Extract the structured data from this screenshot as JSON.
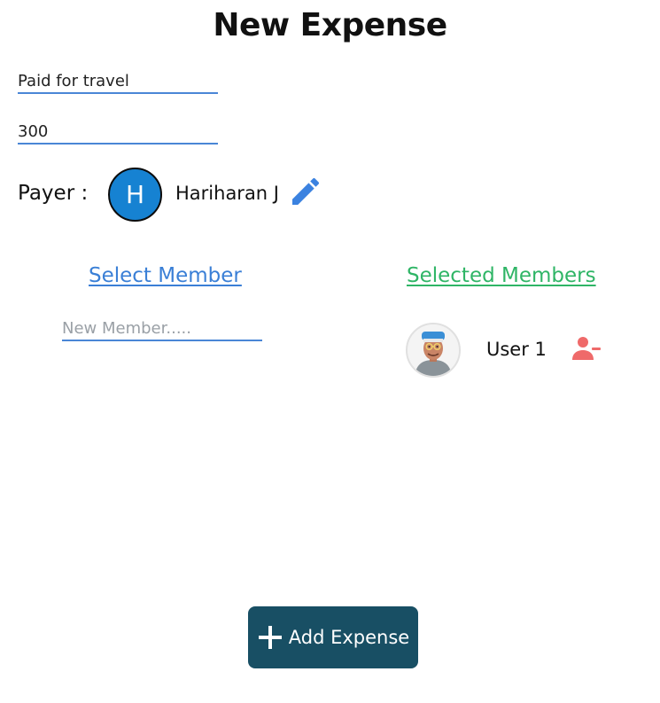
{
  "header": {
    "title": "New Expense"
  },
  "form": {
    "description_value": "Paid for travel",
    "amount_value": "300"
  },
  "payer": {
    "label": "Payer :",
    "initial": "H",
    "name": "Hariharan J",
    "avatar_color": "#1682d2",
    "edit_icon": "pencil-icon"
  },
  "select_member": {
    "heading": "Select Member",
    "input_placeholder": "New Member.....",
    "heading_color": "#3a7fd6"
  },
  "selected_members": {
    "heading": "Selected Members",
    "heading_color": "#2fb566",
    "items": [
      {
        "name": "User 1",
        "avatar_icon": "user-avatar-icon",
        "action_icon": "remove-user-icon"
      }
    ]
  },
  "footer": {
    "add_label": "Add Expense",
    "add_icon": "plus-icon",
    "button_color": "#184f64"
  }
}
